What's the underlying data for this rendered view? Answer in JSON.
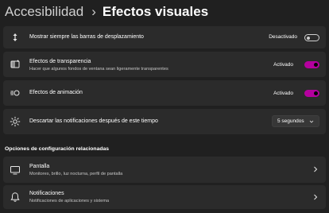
{
  "breadcrumb": {
    "parent": "Accesibilidad",
    "separator": "›",
    "current": "Efectos visuales"
  },
  "settings": [
    {
      "icon": "scrollbar-icon",
      "title": "Mostrar siempre las barras de desplazamiento",
      "subtitle": "",
      "status": "Desactivado",
      "toggle": "off"
    },
    {
      "icon": "transparency-icon",
      "title": "Efectos de transparencia",
      "subtitle": "Hacer que algunos fondos de ventana sean ligeramente transparentes",
      "status": "Activado",
      "toggle": "on"
    },
    {
      "icon": "animation-icon",
      "title": "Efectos de animación",
      "subtitle": "",
      "status": "Activado",
      "toggle": "on"
    },
    {
      "icon": "notification-timer-icon",
      "title": "Descartar las notificaciones después de este tiempo",
      "subtitle": "",
      "dropdown_value": "5 segundos"
    }
  ],
  "related": {
    "heading": "Opciones de configuración relacionadas",
    "items": [
      {
        "icon": "display-icon",
        "title": "Pantalla",
        "subtitle": "Monitores, brillo, luz nocturna, perfil de pantalla"
      },
      {
        "icon": "bell-icon",
        "title": "Notificaciones",
        "subtitle": "Notificaciones de aplicaciones y sistema"
      }
    ]
  },
  "colors": {
    "background": "#202020",
    "card": "#2b2b2b",
    "accent": "#b4009e"
  }
}
